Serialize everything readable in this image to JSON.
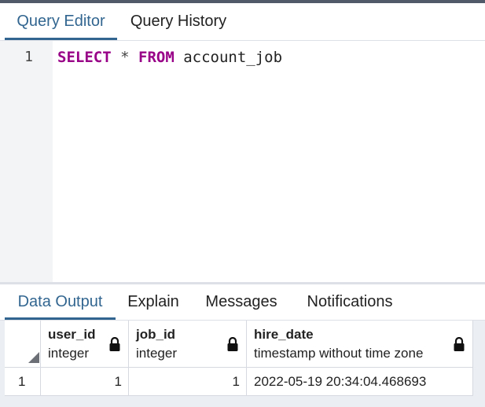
{
  "top_tabs": [
    {
      "label": "Query Editor",
      "active": true
    },
    {
      "label": "Query History",
      "active": false
    }
  ],
  "editor": {
    "line_number": "1",
    "tokens": {
      "kw1": "SELECT",
      "op": "*",
      "kw2": "FROM",
      "ident": "account_job"
    }
  },
  "result_tabs": [
    {
      "label": "Data Output",
      "active": true
    },
    {
      "label": "Explain",
      "active": false
    },
    {
      "label": "Messages",
      "active": false
    },
    {
      "label": "Notifications",
      "active": false
    }
  ],
  "table": {
    "columns": [
      {
        "name": "user_id",
        "type": "integer"
      },
      {
        "name": "job_id",
        "type": "integer"
      },
      {
        "name": "hire_date",
        "type": "timestamp without time zone"
      }
    ],
    "rows": [
      {
        "row_number": "1",
        "cells": [
          "1",
          "1",
          "2022-05-19 20:34:04.468693"
        ]
      }
    ]
  },
  "colors": {
    "accent": "#326690",
    "keyword": "#990088",
    "topbar": "#505a69"
  },
  "icons": [
    "lock-icon",
    "sort-corner-icon"
  ]
}
